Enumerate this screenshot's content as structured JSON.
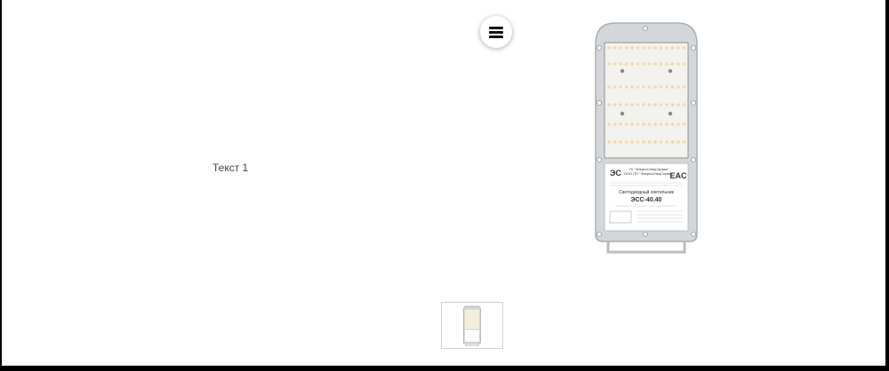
{
  "menu": {
    "icon": "hamburger-menu-icon"
  },
  "slide": {
    "text": "Текст 1"
  },
  "product": {
    "maker_line1": "ГК \"ЭнергоСпецСервис\"",
    "maker_line2": "ООО ПП \"ЭнергоСпецСервис\"",
    "title": "Светодиодный светильник",
    "model": "ЭСС-40.40",
    "cert_mark": "EAC"
  },
  "colors": {
    "background": "#ffffff",
    "frame": "#000000",
    "housing": "#d4d7da",
    "led": "#f2d9a8"
  }
}
